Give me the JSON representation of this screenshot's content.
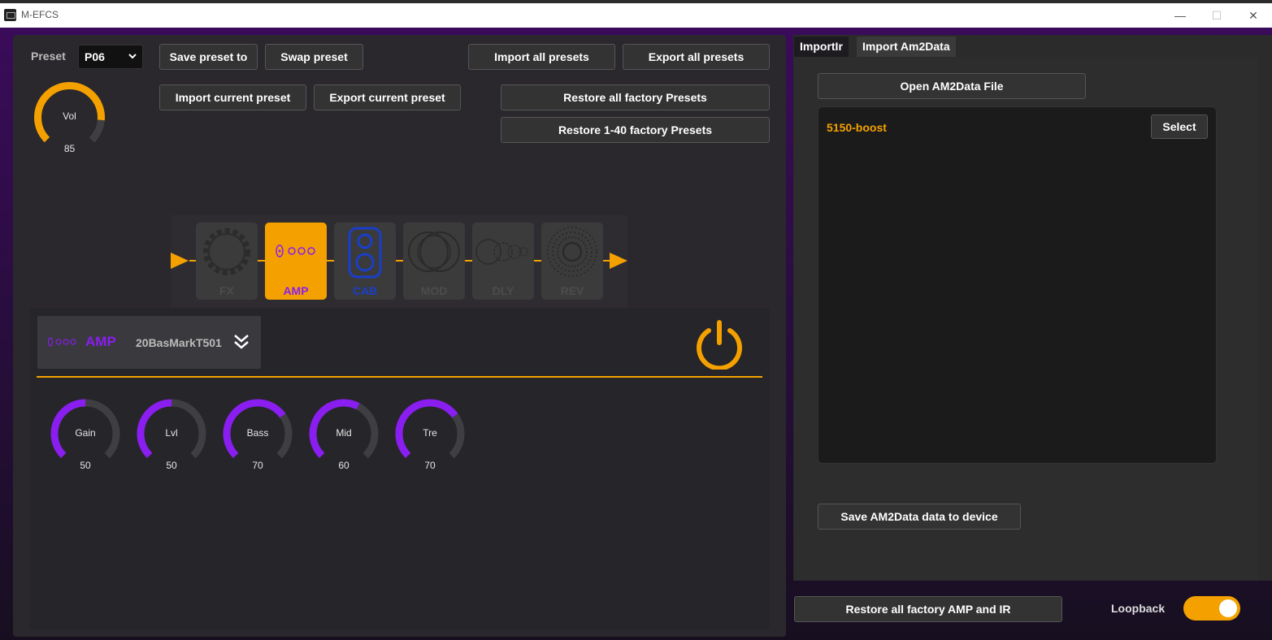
{
  "window": {
    "title": "M-EFCS",
    "minimize": "—",
    "maximize": "☐",
    "close": "✕"
  },
  "preset": {
    "label": "Preset",
    "selected": "P06"
  },
  "volume": {
    "label": "Vol",
    "value": 85
  },
  "toolbar": {
    "save_preset_to": "Save preset to",
    "swap_preset": "Swap preset",
    "import_all_presets": "Import all presets",
    "export_all_presets": "Export all presets",
    "import_current_preset": "Import current preset",
    "export_current_preset": "Export current preset",
    "restore_all_factory_presets": "Restore all factory Presets",
    "restore_1_40_factory_presets": "Restore 1-40 factory Presets"
  },
  "chain": {
    "blocks": [
      {
        "label": "FX",
        "icon": "gear-ring-icon",
        "active": false
      },
      {
        "label": "AMP",
        "icon": "amp-knobs-icon",
        "active": true
      },
      {
        "label": "CAB",
        "icon": "speaker-cabinet-icon",
        "active": false
      },
      {
        "label": "MOD",
        "icon": "overlapping-circles-icon",
        "active": false
      },
      {
        "label": "DLY",
        "icon": "echo-circles-icon",
        "active": false
      },
      {
        "label": "REV",
        "icon": "dotted-rings-icon",
        "active": false
      }
    ],
    "colors": {
      "accent": "#f4a100",
      "amp_purple": "#8a1df0",
      "cab_blue": "#1a3ec8"
    }
  },
  "amp": {
    "type_label": "AMP",
    "model": "20BasMarkT501",
    "power_on": true,
    "knobs": [
      {
        "label": "Gain",
        "value": 50
      },
      {
        "label": "Lvl",
        "value": 50
      },
      {
        "label": "Bass",
        "value": 70
      },
      {
        "label": "Mid",
        "value": 60
      },
      {
        "label": "Tre",
        "value": 70
      }
    ]
  },
  "right_panel": {
    "tabs": [
      {
        "label": "ImportIr",
        "active": false
      },
      {
        "label": "Import Am2Data",
        "active": true
      }
    ],
    "open_file_button": "Open AM2Data File",
    "files": [
      {
        "name": "5150-boost",
        "select_label": "Select"
      }
    ],
    "save_button": "Save AM2Data data to device"
  },
  "footer": {
    "restore_amp_ir": "Restore all factory AMP and IR",
    "loopback_label": "Loopback",
    "loopback_on": true
  }
}
